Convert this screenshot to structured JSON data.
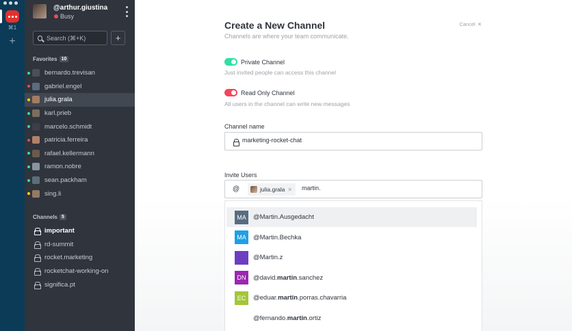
{
  "user": {
    "username": "@arthur.giustina",
    "status": "Busy"
  },
  "rail": {
    "shortcut": "⌘1",
    "add": "+"
  },
  "search": {
    "placeholder": "Search (⌘+K)"
  },
  "sidebar": {
    "favorites": {
      "title": "Favorites",
      "count": "10",
      "items": [
        {
          "label": "bernardo.trevisan",
          "status_color": "#2de0a5",
          "avatar_color": "#4a4f58"
        },
        {
          "label": "gabriel.engel",
          "status_color": "#e54e5b",
          "avatar_color": "#5a6c7d"
        },
        {
          "label": "julia.grala",
          "status_color": "#ffd21f",
          "avatar_color": "#a47c63"
        },
        {
          "label": "karl.prieb",
          "status_color": "#2de0a5",
          "avatar_color": "#7c6d5c"
        },
        {
          "label": "marcelo.schmidt",
          "status_color": "#2de0a5",
          "avatar_color": "#3c3f45"
        },
        {
          "label": "patricia.ferreira",
          "status_color": "#e54e5b",
          "avatar_color": "#b0826a"
        },
        {
          "label": "rafael.kellermann",
          "status_color": "#2de0a5",
          "avatar_color": "#6b5a4c"
        },
        {
          "label": "ramon.nobre",
          "status_color": "#2de0a5",
          "avatar_color": "#8a94a0"
        },
        {
          "label": "sean.packham",
          "status_color": "#2de0a5",
          "avatar_color": "#5d6e7a"
        },
        {
          "label": "sing.li",
          "status_color": "#ffd21f",
          "avatar_color": "#947a62"
        }
      ]
    },
    "channels": {
      "title": "Channels",
      "count": "5",
      "items": [
        {
          "label": "important"
        },
        {
          "label": "rd-summit"
        },
        {
          "label": "rocket.marketing"
        },
        {
          "label": "rocketchat-working-on"
        },
        {
          "label": "significa.pt"
        }
      ]
    }
  },
  "main": {
    "title": "Create a New Channel",
    "subtitle": "Channels are where your team communicate.",
    "cancel_label": "Cancel",
    "private": {
      "label": "Private Channel",
      "hint": "Just invited people can access this channel",
      "color": "#2de0a5"
    },
    "readonly": {
      "label": "Read Only Channel",
      "hint": "All users in the channel can write new messages",
      "color": "#f5455c"
    },
    "channel_name": {
      "label": "Channel name",
      "value": "marketing-rocket-chat"
    },
    "invite": {
      "label": "Invite Users",
      "at": "@",
      "chip": "julia.grala",
      "value": "martin."
    },
    "suggestions": [
      {
        "initials": "MA",
        "color": "#596d80",
        "pre": "@Martin.Ausgedacht",
        "bold": "",
        "post": ""
      },
      {
        "initials": "MA",
        "color": "#1ea0e6",
        "pre": "@Martin.Bechka",
        "bold": "",
        "post": ""
      },
      {
        "initials": "",
        "color": "#6c3fc2",
        "pre": "@Martin.z",
        "bold": "",
        "post": ""
      },
      {
        "initials": "DN",
        "color": "#9c27b0",
        "pre": "@david.",
        "bold": "martin",
        "post": ".sanchez"
      },
      {
        "initials": "EC",
        "color": "#a4c639",
        "pre": "@eduar.",
        "bold": "martin",
        "post": ".porras.chavarria"
      },
      {
        "initials": "",
        "color": "#ffffff",
        "pre": "@fernando.",
        "bold": "martin",
        "post": ".ortiz"
      }
    ]
  }
}
